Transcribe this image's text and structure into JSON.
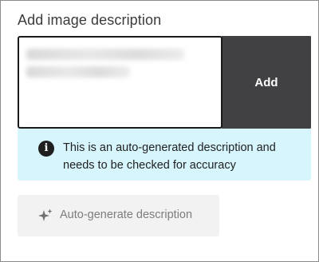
{
  "dialog": {
    "title": "Add image description"
  },
  "description_input": {
    "value": "",
    "placeholder": ""
  },
  "add_button": {
    "label": "Add"
  },
  "notice": {
    "icon": "info-icon",
    "icon_glyph": "i",
    "text": "This is an auto-generated description and needs to be checked for accuracy"
  },
  "autogenerate_button": {
    "icon": "sparkle-icon",
    "label": "Auto-generate description"
  },
  "colors": {
    "add_button_bg": "#414143",
    "notice_bg": "#d6f5fd",
    "autogen_bg": "#f2f2f2"
  }
}
